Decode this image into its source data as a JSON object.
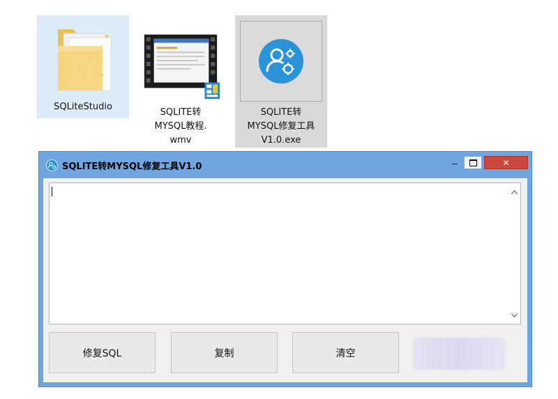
{
  "desktop": {
    "icons": [
      {
        "label_lines": [
          "SQLiteStudio"
        ]
      },
      {
        "label_lines": [
          "SQLITE转",
          "MYSQL教程.",
          "wmv"
        ]
      },
      {
        "label_lines": [
          "SQLITE转",
          "MYSQL修复工具",
          "V1.0.exe"
        ]
      }
    ]
  },
  "window": {
    "title": "SQLITE转MYSQL修复工具V1.0",
    "minimize_glyph": "–",
    "close_glyph": "✕",
    "textarea_value": "",
    "buttons": {
      "repair": "修复SQL",
      "copy": "复制",
      "clear": "清空"
    }
  },
  "colors": {
    "window_frame": "#6fa6df",
    "close_button": "#c9473c",
    "selected_icon_bg": "#dcecfb",
    "exe_icon_blue": "#2b93d8"
  }
}
